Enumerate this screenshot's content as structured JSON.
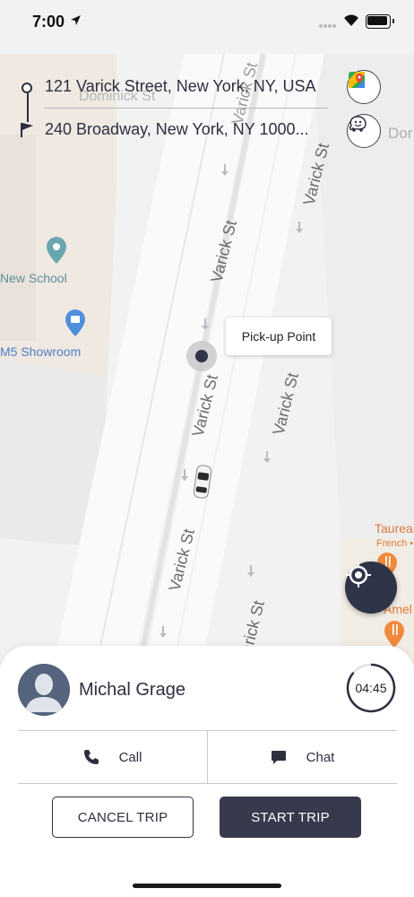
{
  "status_bar": {
    "time": "7:00"
  },
  "route": {
    "from": "121 Varick Street, New York, NY, USA",
    "to": "240 Broadway, New York, NY 1000..."
  },
  "map": {
    "street_labels": [
      "Varick St",
      "Varick St",
      "Varick St",
      "Varick St",
      "Varick St",
      "Varick St",
      "Varick St"
    ],
    "street_partial": "Dominick St",
    "street_partial_right": "Dor",
    "poi": {
      "new_school": "New School",
      "showroom": "M5 Showroom",
      "taurean": "Taurea",
      "taurean_sub": "French •",
      "amel": "Amel"
    },
    "pickup_label": "Pick-up Point"
  },
  "driver": {
    "name": "Michal Grage",
    "timer": "04:45"
  },
  "actions": {
    "call": "Call",
    "chat": "Chat"
  },
  "buttons": {
    "cancel": "CANCEL TRIP",
    "start": "START TRIP"
  },
  "colors": {
    "primary": "#373a4d",
    "poi_blue": "#4f8fdc",
    "poi_teal": "#6aa6b0",
    "poi_orange": "#f08a3e"
  },
  "icons": [
    "location-arrow-icon",
    "signal-icon",
    "wifi-icon",
    "battery-icon",
    "origin-pin-icon",
    "destination-flag-icon",
    "google-maps-icon",
    "waze-icon",
    "my-location-icon",
    "phone-icon",
    "chat-icon",
    "person-icon"
  ]
}
